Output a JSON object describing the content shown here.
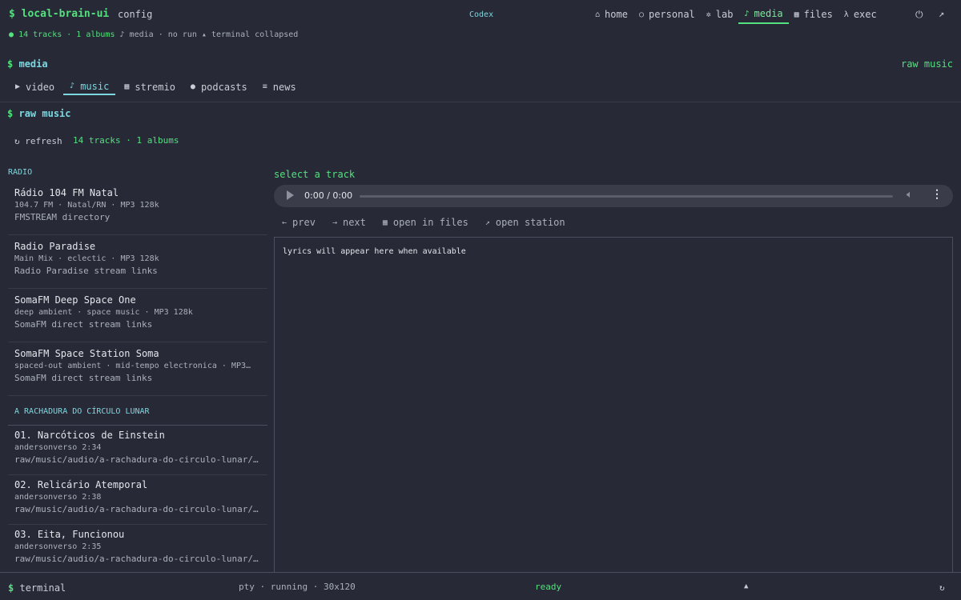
{
  "app": {
    "brand": "$ local-brain-ui",
    "config_label": "config",
    "center_label": "Codex"
  },
  "nav": {
    "items": [
      {
        "icon": "⌂",
        "label": "home"
      },
      {
        "icon": "○",
        "label": "personal"
      },
      {
        "icon": "✲",
        "label": "lab"
      },
      {
        "icon": "♪",
        "label": "media"
      },
      {
        "icon": "▦",
        "label": "files"
      },
      {
        "icon": "λ",
        "label": "exec"
      }
    ],
    "power_icon": "⏻",
    "external_icon": "↗"
  },
  "status": {
    "dot": "●",
    "tracks_albums": "14 tracks · 1 albums",
    "section": "♪ media",
    "run": "· no run",
    "terminal": "▴ terminal collapsed"
  },
  "media": {
    "heading_prompt": "$",
    "heading": "media",
    "raw_music_link": "raw music",
    "tabs": [
      {
        "icon": "▶",
        "label": "video"
      },
      {
        "icon": "♪",
        "label": "music"
      },
      {
        "icon": "▦",
        "label": "stremio"
      },
      {
        "icon": "●",
        "label": "podcasts"
      },
      {
        "icon": "≡",
        "label": "news"
      }
    ]
  },
  "raw": {
    "heading_prompt": "$",
    "heading": "raw music",
    "refresh": "↻ refresh",
    "count": "14 tracks · 1 albums"
  },
  "radio": {
    "title": "RADIO",
    "stations": [
      {
        "name": "Rádio 104 FM Natal",
        "meta": "104.7 FM · Natal/RN · MP3 128k",
        "source": "FMSTREAM directory"
      },
      {
        "name": "Radio Paradise",
        "meta": "Main Mix · eclectic · MP3 128k",
        "source": "Radio Paradise stream links"
      },
      {
        "name": "SomaFM Deep Space One",
        "meta": "deep ambient · space music · MP3 128k",
        "source": "SomaFM direct stream links"
      },
      {
        "name": "SomaFM Space Station Soma",
        "meta": "spaced-out ambient · mid-tempo electronica · MP3…",
        "source": "SomaFM direct stream links"
      }
    ]
  },
  "album": {
    "title": "A RACHADURA DO CÍRCULO LUNAR",
    "tracks": [
      {
        "name": "01. Narcóticos de Einstein",
        "meta": "andersonverso  2:34",
        "path": "raw/music/audio/a-rachadura-do-circulo-lunar/…"
      },
      {
        "name": "02. Relicário Atemporal",
        "meta": "andersonverso  2:38",
        "path": "raw/music/audio/a-rachadura-do-circulo-lunar/…"
      },
      {
        "name": "03. Eita, Funcionou",
        "meta": "andersonverso  2:35",
        "path": "raw/music/audio/a-rachadura-do-circulo-lunar/…"
      }
    ]
  },
  "player": {
    "prompt": "select a track",
    "time": "0:00 / 0:00",
    "progress": 0,
    "controls": [
      {
        "icon": "←",
        "label": "prev"
      },
      {
        "icon": "→",
        "label": "next"
      },
      {
        "icon": "▦",
        "label": "open in files"
      },
      {
        "icon": "↗",
        "label": "open station"
      }
    ],
    "lyrics_placeholder": "lyrics will appear here when available"
  },
  "terminal": {
    "prompt": "$",
    "title": "terminal",
    "info": "pty · running · 30x120",
    "status": "ready",
    "toggle_icon": "▲",
    "refresh_icon": "↻"
  }
}
